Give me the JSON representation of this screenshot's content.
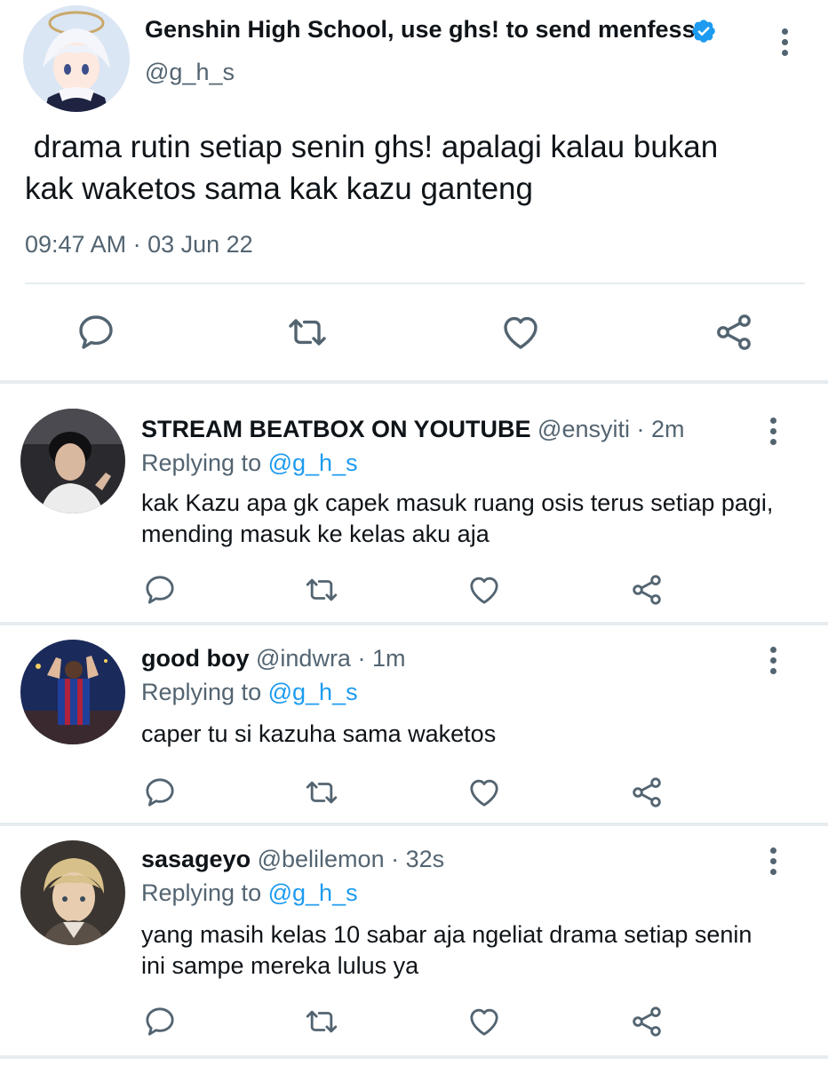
{
  "main_tweet": {
    "display_name": "Genshin High School, use ghs! to send menfess",
    "handle": "@g_h_s",
    "text": " drama rutin setiap senin ghs! apalagi kalau bukan\nkak waketos sama kak kazu ganteng",
    "timestamp": "09:47 AM · 03 Jun 22",
    "verified": true,
    "actions": [
      "reply-icon",
      "retweet-icon",
      "like-icon",
      "share-icon"
    ]
  },
  "replies": [
    {
      "display_name": "STREAM BEATBOX ON YOUTUBE",
      "handle": "@ensyiti",
      "time": "· 2m",
      "replying_label": "Replying to",
      "replying_to": "@g_h_s",
      "text": "kak Kazu apa gk capek masuk ruang osis terus setiap pagi, mending masuk ke kelas aku aja"
    },
    {
      "display_name": "good boy",
      "handle": "@indwra",
      "time": "· 1m",
      "replying_label": "Replying to",
      "replying_to": "@g_h_s",
      "text": "caper tu si kazuha sama waketos"
    },
    {
      "display_name": "sasageyo",
      "handle": "@belilemon",
      "time": "· 32s",
      "replying_label": "Replying to",
      "replying_to": "@g_h_s",
      "text": "yang masih kelas 10 sabar aja ngeliat drama setiap senin ini sampe mereka lulus ya"
    }
  ],
  "colors": {
    "text": "#0f1419",
    "secondary": "#536471",
    "accent": "#1d9bf0",
    "divider": "#e6ecf0"
  }
}
